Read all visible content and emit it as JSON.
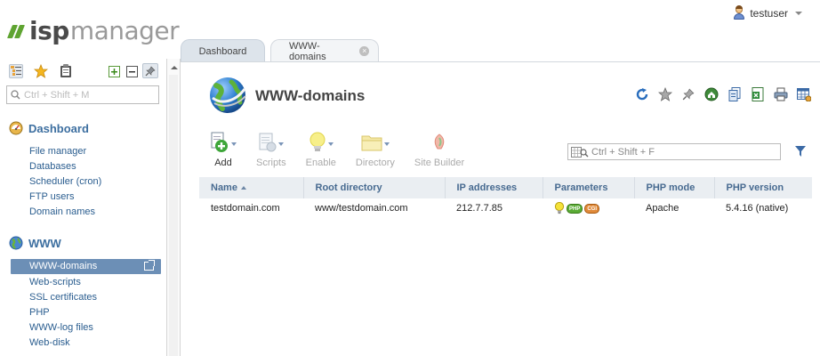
{
  "brand": {
    "part1": "isp",
    "part2": "manager"
  },
  "user": {
    "name": "testuser"
  },
  "tabs": [
    {
      "label": "Dashboard"
    },
    {
      "label": "WWW-domains"
    }
  ],
  "sidebar": {
    "search_placeholder": "Ctrl + Shift + M",
    "sections": [
      {
        "title": "Dashboard",
        "items": [
          "File manager",
          "Databases",
          "Scheduler (cron)",
          "FTP users",
          "Domain names"
        ]
      },
      {
        "title": "WWW",
        "items": [
          "WWW-domains",
          "Web-scripts",
          "SSL certificates",
          "PHP",
          "WWW-log files",
          "Web-disk"
        ]
      }
    ],
    "active_item": "WWW-domains"
  },
  "main": {
    "title": "WWW-domains",
    "toolbar": [
      {
        "label": "Add",
        "icon": "add-document-icon",
        "enabled": true
      },
      {
        "label": "Scripts",
        "icon": "scripts-icon",
        "enabled": false
      },
      {
        "label": "Enable",
        "icon": "lightbulb-icon",
        "enabled": false
      },
      {
        "label": "Directory",
        "icon": "folder-icon",
        "enabled": false
      },
      {
        "label": "Site Builder",
        "icon": "site-builder-icon",
        "enabled": false
      }
    ],
    "filter_placeholder": "Ctrl + Shift + F",
    "columns": [
      "Name",
      "Root directory",
      "IP addresses",
      "Parameters",
      "PHP mode",
      "PHP version"
    ],
    "rows": [
      {
        "name": "testdomain.com",
        "root": "www/testdomain.com",
        "ip": "212.7.7.85",
        "params": [
          "lightbulb-icon",
          "php-badge",
          "cgi-badge"
        ],
        "php_mode": "Apache",
        "php_version": "5.4.16 (native)"
      }
    ],
    "param_badges": {
      "php": "PHP",
      "cgi": "CGI"
    }
  },
  "colors": {
    "accent": "#3d6fa0",
    "brand_green": "#5fa431",
    "active_menu": "#6c8fb6",
    "header_bg": "#eaeef2"
  }
}
